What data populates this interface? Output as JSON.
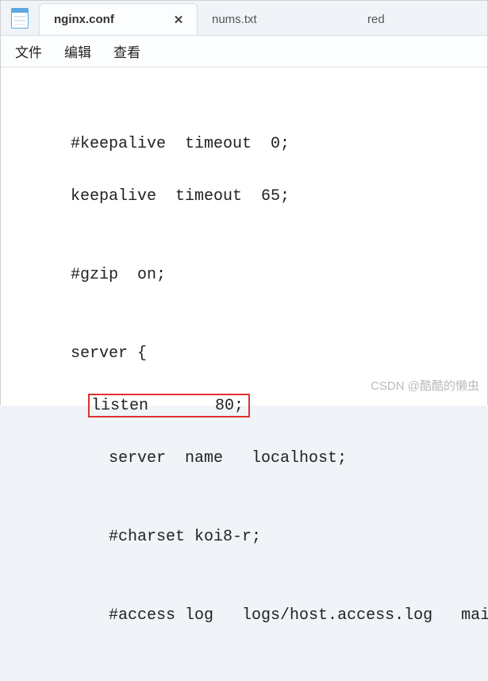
{
  "tabs": {
    "active": {
      "label": "nginx.conf",
      "close": "✕"
    },
    "inactive": {
      "label": "nums.txt"
    },
    "overflow": {
      "label": "red"
    }
  },
  "menu": {
    "file": "文件",
    "edit": "编辑",
    "view": "查看"
  },
  "content": {
    "l1": "",
    "l2": "    #keepalive  timeout  0;",
    "l3": "    keepalive  timeout  65;",
    "l4": "",
    "l5": "    #gzip  on;",
    "l6": "",
    "l7": "    server {",
    "l8a": "      ",
    "l8b": "listen       80;",
    "l9": "        server  name   localhost;",
    "l10": "",
    "l11": "        #charset koi8-r;",
    "l12": "",
    "l13": "        #access log   logs/host.access.log   main;"
  },
  "watermark": "CSDN @酷酷的懒虫"
}
